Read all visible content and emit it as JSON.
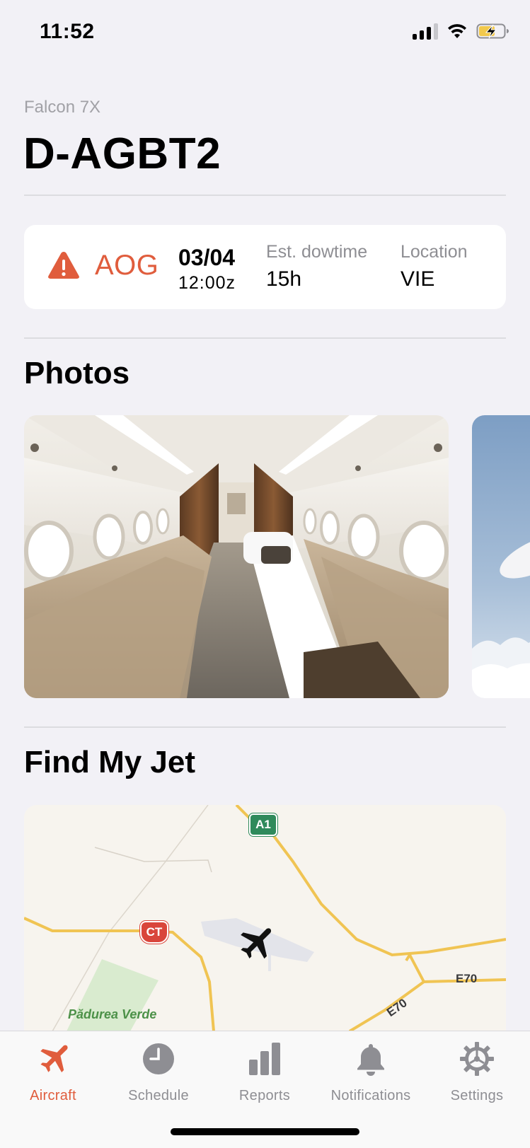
{
  "status_bar": {
    "time": "11:52",
    "icons": [
      "cellular-signal-icon",
      "wifi-icon",
      "battery-charging-icon"
    ]
  },
  "header": {
    "subtitle": "Falcon 7X",
    "title": "D-AGBT2"
  },
  "status_card": {
    "status": "AOG",
    "status_icon": "warning-icon",
    "status_color": "#e05d3d",
    "date": "03/04",
    "time": "12:00z",
    "downtime_label": "Est. dowtime",
    "downtime_value": "15h",
    "location_label": "Location",
    "location_value": "VIE"
  },
  "photos": {
    "title": "Photos",
    "items": [
      "cabin-interior-photo",
      "aircraft-exterior-photo"
    ]
  },
  "map": {
    "title": "Find My Jet",
    "labels": {
      "forest": "Pădurea Verde",
      "road_a1": "A1",
      "road_ct": "CT",
      "road_e70_1": "E70",
      "road_e70_2": "E70"
    },
    "marker_icon": "airplane-icon"
  },
  "tab_bar": {
    "accent_color": "#e05d3d",
    "tabs": [
      {
        "label": "Aircraft",
        "icon": "airplane-icon",
        "active": true
      },
      {
        "label": "Schedule",
        "icon": "clock-icon",
        "active": false
      },
      {
        "label": "Reports",
        "icon": "bar-chart-icon",
        "active": false
      },
      {
        "label": "Notifications",
        "icon": "bell-icon",
        "active": false
      },
      {
        "label": "Settings",
        "icon": "gear-icon",
        "active": false
      }
    ]
  }
}
